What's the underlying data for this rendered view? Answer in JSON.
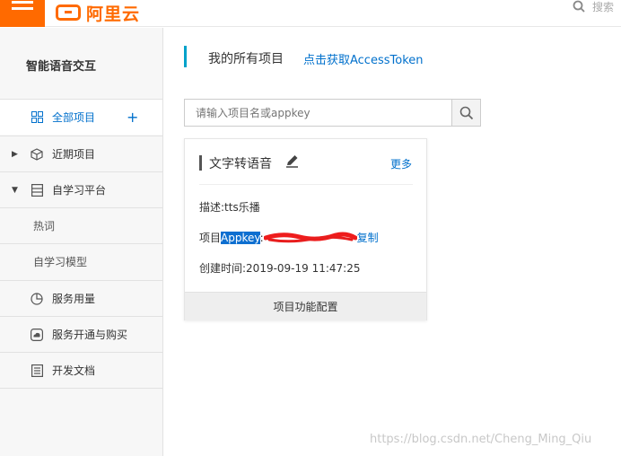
{
  "topbar": {
    "logo_text": "阿里云",
    "search_label": "搜索"
  },
  "sidebar": {
    "title": "智能语音交互",
    "items": [
      {
        "label": "全部项目",
        "icon": "grid-icon",
        "active": true
      },
      {
        "label": "近期项目",
        "icon": "cube-icon"
      },
      {
        "label": "自学习平台",
        "icon": "server-icon"
      },
      {
        "label": "热词"
      },
      {
        "label": "自学习模型"
      },
      {
        "label": "服务用量",
        "icon": "pie-chart-icon"
      },
      {
        "label": "服务开通与购买",
        "icon": "cloud-icon"
      },
      {
        "label": "开发文档",
        "icon": "document-icon"
      }
    ]
  },
  "main": {
    "title": "我的所有项目",
    "token_link": "点击获取AccessToken",
    "search_placeholder": "请输入项目名或appkey"
  },
  "card": {
    "title": "文字转语音",
    "more": "更多",
    "desc_label": "描述:",
    "desc_value": "tts乐播",
    "appkey_prefix": "项目",
    "appkey_highlight": "Appkey",
    "appkey_colon": ":",
    "copy": "复制",
    "created_label": "创建时间:",
    "created_value": "2019-09-19 11:47:25",
    "footer": "项目功能配置"
  },
  "watermark": "https://blog.csdn.net/Cheng_Ming_Qiu",
  "colors": {
    "brand": "#ff6a00",
    "link": "#0070cc",
    "accent_bar": "#00a2ca"
  }
}
